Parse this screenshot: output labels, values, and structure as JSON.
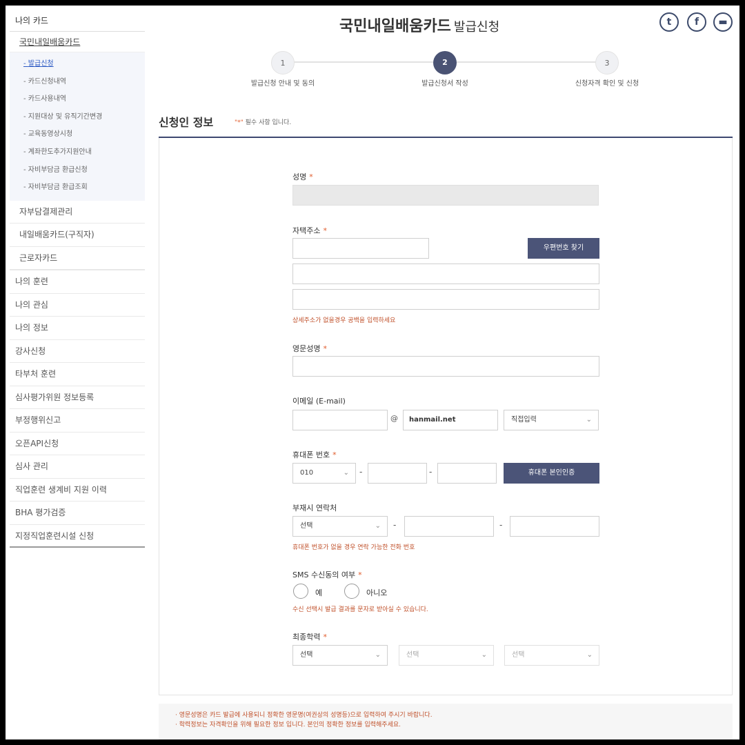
{
  "page": {
    "title": "국민내일배움카드",
    "title_sub": "발급신청"
  },
  "social": [
    "twitter-icon",
    "facebook-icon",
    "share-icon"
  ],
  "social_glyphs": [
    "t",
    "f",
    "▬"
  ],
  "sidebar": {
    "top": "나의 카드",
    "sub1": "국민내일배움카드",
    "leaves": [
      "발급신청",
      "카드신청내역",
      "카드사용내역",
      "지원대상 및 유직기간변경",
      "교육동영상시청",
      "계좌한도추가지원안내",
      "자비부담금 환급신청",
      "자비부담금 환급조회"
    ],
    "sub_items": [
      "자부담결제관리",
      "내일배움카드(구직자)",
      "근로자카드"
    ],
    "items": [
      "나의 훈련",
      "나의 관심",
      "나의 정보",
      "강사신청",
      "타부처 훈련",
      "심사평가위원 정보등록",
      "부정행위신고",
      "오픈API신청",
      "심사 관리",
      "직업훈련 생계비 지원 이력",
      "BHA 평가검증",
      "지정직업훈련시설 신청"
    ]
  },
  "steps": [
    {
      "num": "1",
      "label": "발급신청 안내 및 동의"
    },
    {
      "num": "2",
      "label": "발급신청서 작성"
    },
    {
      "num": "3",
      "label": "신청자격 확인 및 신청"
    }
  ],
  "section": {
    "title": "신청인 정보",
    "req_star": "\"*\"",
    "req_note": " 필수 사항 입니다."
  },
  "form": {
    "name": {
      "label": "성명",
      "star": "*",
      "value": ""
    },
    "address": {
      "label": "자택주소",
      "star": "*",
      "button": "우편번호 찾기",
      "hint": "상세주소가 없을경우 공백을 입력하세요"
    },
    "eng_name": {
      "label": "영문성명",
      "star": "*"
    },
    "email": {
      "label": "이메일 (E-mail)",
      "at": "@",
      "domain": "hanmail.net",
      "select": "직접입력"
    },
    "mobile": {
      "label": "휴대폰 번호",
      "star": "*",
      "prefix": "010",
      "dash": "-",
      "button": "휴대폰 본인인증"
    },
    "absent": {
      "label": "부재시 연락처",
      "select": "선택",
      "dash": "-",
      "hint": "휴대폰 번호가 없을 경우 연락 가능한 전화 번호"
    },
    "sms": {
      "label": "SMS 수신동의 여부",
      "star": "*",
      "yes": "예",
      "no": "아니오",
      "hint": "수신 선택시 발급 결과를 문자로 받아실 수 있습니다."
    },
    "edu": {
      "label": "최종학력",
      "star": "*",
      "sel1": "선택",
      "sel2": "선택",
      "sel3": "선택"
    }
  },
  "notes": [
    "· 영문성명은 카드 발급에 사용되니 정확한 영문명(여권상의 성명등)으로 입력하여 주시기 바랍니다.",
    "· 학력정보는 자격확인을 위해 필요한 정보 입니다. 본인의 정확한 정보를 입력해주세요."
  ],
  "icons": {
    "chevron": "⌄"
  }
}
